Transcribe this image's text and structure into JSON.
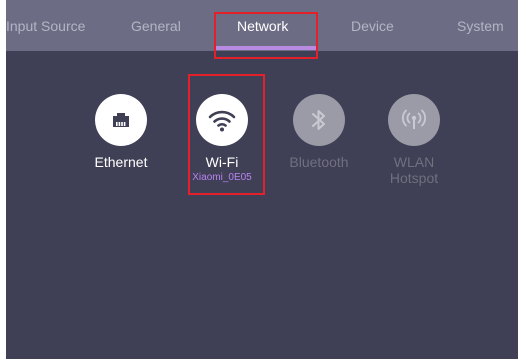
{
  "tabs": {
    "input_source": "Input Source",
    "general": "General",
    "network": "Network",
    "device": "Device",
    "system": "System"
  },
  "network": {
    "ethernet": {
      "label": "Ethernet",
      "icon": "ethernet-port-icon"
    },
    "wifi": {
      "label": "Wi-Fi",
      "ssid": "Xiaomi_0E05",
      "icon": "wifi-icon"
    },
    "bluetooth": {
      "label": "Bluetooth",
      "icon": "bluetooth-icon"
    },
    "wlan_hotspot": {
      "label_line1": "WLAN",
      "label_line2": "Hotspot",
      "icon": "hotspot-icon"
    }
  },
  "colors": {
    "background": "#3f3f55",
    "tabbar": "#6c6c84",
    "accent": "#b88ae2",
    "ssid": "#b984f0",
    "highlight": "#e4202a",
    "disabled_icon": "#9b9ba7"
  }
}
